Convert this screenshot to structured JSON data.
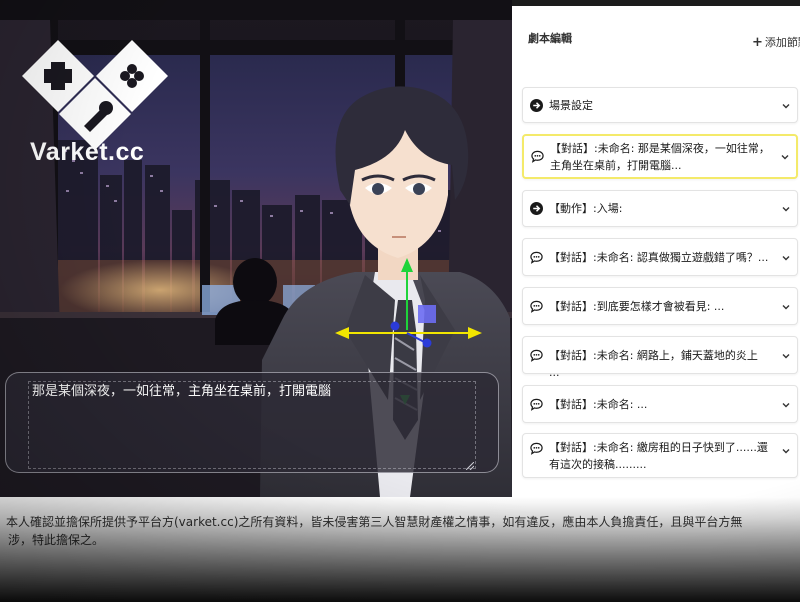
{
  "brand": {
    "logo_text": "Varket.cc"
  },
  "scene": {
    "dialog_text": "那是某個深夜，一如往常，主角坐在桌前，打開電腦"
  },
  "panel": {
    "title": "劇本編輯",
    "add_label": "添加節點",
    "nodes": [
      {
        "icon": "arrow-circle-icon",
        "label": "場景設定",
        "active": false
      },
      {
        "icon": "speech-bubble-icon",
        "label": "【對話】:未命名: 那是某個深夜，一如往常，主角坐在桌前，打開電腦...",
        "active": true
      },
      {
        "icon": "arrow-circle-icon",
        "label": "【動作】:入場:",
        "active": false
      },
      {
        "icon": "speech-bubble-icon",
        "label": "【對話】:未命名: 認真做獨立遊戲錯了嗎？...",
        "active": false
      },
      {
        "icon": "speech-bubble-icon",
        "label": "【對話】:到底要怎樣才會被看見: ...",
        "active": false
      },
      {
        "icon": "speech-bubble-icon",
        "label": "【對話】:未命名: 網路上，鋪天蓋地的炎上 ...",
        "active": false
      },
      {
        "icon": "speech-bubble-icon",
        "label": "【對話】:未命名: ...",
        "active": false
      },
      {
        "icon": "speech-bubble-icon",
        "label": "【對話】:未命名: 繳房租的日子快到了......還有這次的接稿.........",
        "active": false
      }
    ]
  },
  "disclaimer": {
    "line1": "本人確認並擔保所提供予平台方(varket.cc)之所有資料，皆未侵害第三人智慧財產權之情事，如有違反，應由本人負擔責任，且與平台方無",
    "line2": "涉，特此擔保之。"
  },
  "colors": {
    "active_border": "#f4ea6a",
    "gizmo_x": "#f2e600",
    "gizmo_y": "#1ed43a",
    "gizmo_z": "#2b3bd8"
  }
}
